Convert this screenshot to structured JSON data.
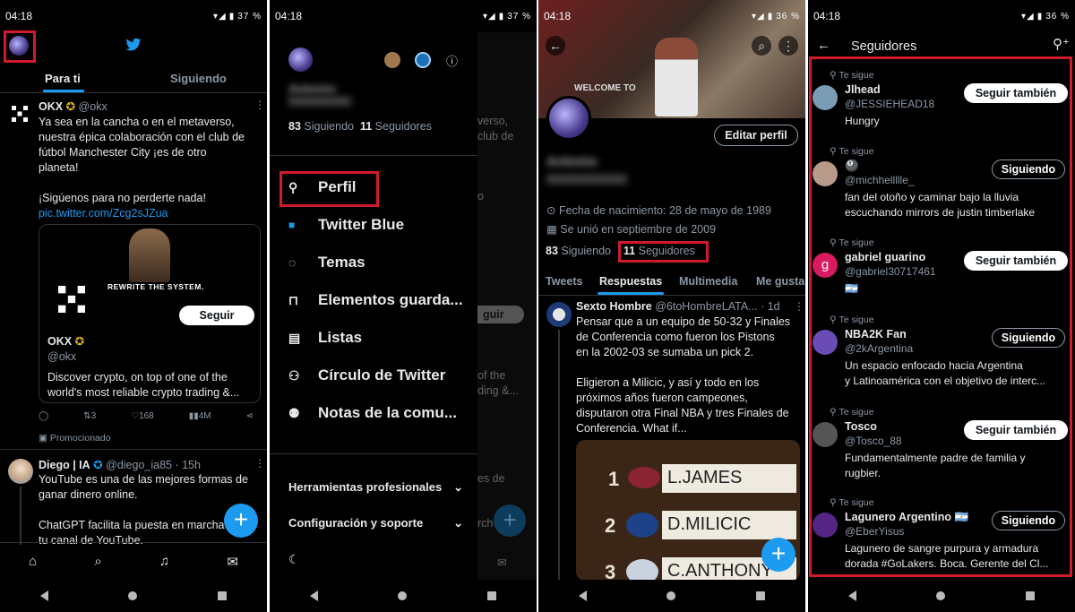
{
  "screens": {
    "home": {
      "status": {
        "time": "04:18",
        "battery": "37 %"
      },
      "tabs": [
        "Para ti",
        "Siguiendo"
      ],
      "post1": {
        "name": "OKX",
        "handle": "@okx",
        "text_lines": [
          "Ya sea en la cancha o en el metaverso,",
          "nuestra épica colaboración con el club de",
          "fútbol Manchester City ¡es de otro",
          "planeta!",
          "",
          "¡Sigúenos para no perderte nada!"
        ],
        "link": "pic.twitter.com/Zcg2sJZua",
        "card_banner": "REWRITE THE SYSTEM.",
        "card_button": "Seguir",
        "card_name": "OKX",
        "card_handle": "@okx",
        "card_desc_lines": [
          "Discover crypto, on top of one of the",
          "world's most reliable crypto trading &..."
        ],
        "actions": {
          "retweets": "3",
          "likes": "168",
          "views": "4M"
        },
        "promoted": "Promocionado"
      },
      "post2": {
        "name": "Diego | IA",
        "handle": "@diego_ia85",
        "time": "· 15h",
        "text_lines": [
          "YouTube es una de las mejores formas de",
          "ganar dinero online.",
          "",
          "ChatGPT facilita la puesta en marcha",
          "tu canal de YouTube."
        ]
      }
    },
    "menu": {
      "status": {
        "time": "04:18",
        "battery": "37 %"
      },
      "name_blurred": "Antonio",
      "following_count": "83",
      "following_label": "Siguiendo",
      "followers_count": "11",
      "followers_label": "Seguidores",
      "items": [
        "Perfil",
        "Twitter Blue",
        "Temas",
        "Elementos guarda...",
        "Listas",
        "Círculo de Twitter",
        "Notas de la comu..."
      ],
      "sections": [
        "Herramientas profesionales",
        "Configuración y soporte"
      ],
      "behind": {
        "line1": "verso,",
        "line2": "club de",
        "line3": "o",
        "follow": "guir",
        "line4": "of the",
        "line5": "ding &...",
        "line6": "es de",
        "line7": "rch"
      }
    },
    "profile": {
      "status": {
        "time": "04:18",
        "battery": "36 %"
      },
      "banner_text": "WELCOME TO",
      "edit_button": "Editar perfil",
      "name_blurred": "Antonio",
      "birth": "Fecha de nacimiento: 28 de mayo de 1989",
      "joined": "Se unió en septiembre de 2009",
      "following_count": "83",
      "following_label": "Siguiendo",
      "followers_count": "11",
      "followers_label": "Seguidores",
      "tabs": [
        "Tweets",
        "Respuestas",
        "Multimedia",
        "Me gusta"
      ],
      "reply": {
        "name": "Sexto Hombre",
        "handle": "@6toHombreLATA...",
        "time": "· 1d",
        "text_lines": [
          "Pensar que a un equipo de 50-32 y Finales",
          "de Conferencia como fueron los Pistons",
          "en la 2002-03 se sumaba un pick 2.",
          "",
          "Eligieron a Milicic, y así y todo en los",
          "próximos años fueron campeones,",
          "disputaron otra Final NBA y tres Finales de",
          "Conferencia. What if..."
        ],
        "board": [
          {
            "num": "1",
            "name": "L.JAMES"
          },
          {
            "num": "2",
            "name": "D.MILICIC"
          },
          {
            "num": "3",
            "name": "C.ANTHONY"
          }
        ]
      }
    },
    "followers": {
      "status": {
        "time": "04:18",
        "battery": "36 %"
      },
      "title": "Seguidores",
      "te_sigue": "Te sigue",
      "list": [
        {
          "name": "Jlhead",
          "handle": "@JESSIEHEAD18",
          "bio": [
            "Hungry"
          ],
          "button": "Seguir también",
          "style": "white",
          "avatar": "#7a9cb4"
        },
        {
          "name": "🎱",
          "handle": "@michhellllle_",
          "bio": [
            "fan del otoño y caminar bajo la lluvia",
            "escuchando mirrors de justin timberlake"
          ],
          "button": "Siguiendo",
          "style": "outline",
          "avatar": "#b89a8a"
        },
        {
          "name": "gabriel guarino",
          "handle": "@gabriel30717461",
          "bio": [
            "🇦🇷"
          ],
          "button": "Seguir también",
          "style": "white",
          "avatar": "#d81b60",
          "initial": "g"
        },
        {
          "name": "NBA2K Fan",
          "handle": "@2kArgentina",
          "bio": [
            "Un espacio enfocado hacia Argentina",
            "y Latinoamérica con el objetivo de interc..."
          ],
          "button": "Siguiendo",
          "style": "outline",
          "avatar": "#6b4bb5"
        },
        {
          "name": "Tosco",
          "handle": "@Tosco_88",
          "bio": [
            "Fundamentalmente padre de familia y",
            "rugbier."
          ],
          "button": "Seguir también",
          "style": "white",
          "avatar": "#555555"
        },
        {
          "name": "Lagunero Argentino 🇦🇷",
          "handle": "@EberYisus",
          "bio": [
            "Lagunero de sangre purpura y armadura",
            "dorada #GoLakers. Boca. Gerente del Cl..."
          ],
          "button": "Siguiendo",
          "style": "outline",
          "avatar": "#552583"
        }
      ]
    }
  },
  "colors": {
    "accent": "#1d9bf0",
    "highlight": "#d11a2a",
    "background": "#000000"
  }
}
